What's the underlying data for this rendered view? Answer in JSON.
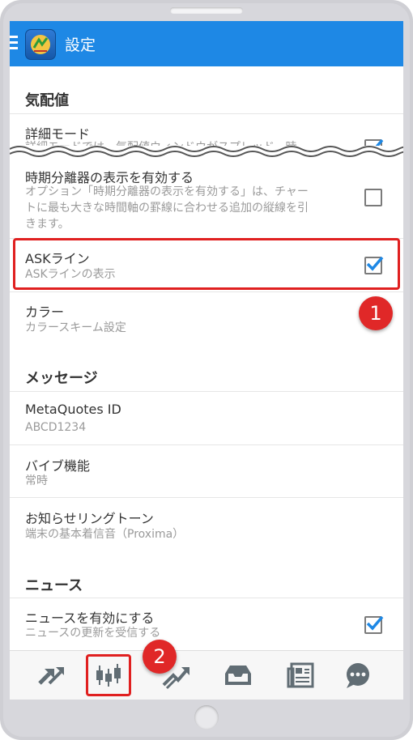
{
  "header": {
    "title": "設定",
    "app_icon": "metatrader-icon",
    "menu_icon": "hamburger-icon"
  },
  "colors": {
    "accent": "#1e88e5",
    "highlight": "#e02020",
    "check": "#1e88e5"
  },
  "sections": {
    "quotes": {
      "title": "気配値",
      "detail_mode": {
        "title": "詳細モード",
        "sub": "詳細モードでは、気配値ウィンドウがスプレッド、時",
        "checked": true
      },
      "period_sep": {
        "title": "時期分離器の表示を有効する",
        "sub_line1": "オプション「時期分離器の表示を有効する」は、チャー",
        "sub_line2": "トに最も大きな時間軸の罫線に合わせる追加の縦線を引",
        "sub_line3": "きます。",
        "checked": false
      },
      "ask_line": {
        "title": "ASKライン",
        "sub": "ASKラインの表示",
        "checked": true
      },
      "color": {
        "title": "カラー",
        "sub": "カラースキーム設定"
      }
    },
    "messages": {
      "title": "メッセージ",
      "metaquotes_id": {
        "title": "MetaQuotes ID",
        "sub": "ABCD1234"
      },
      "vibrate": {
        "title": "バイブ機能",
        "sub": "常時"
      },
      "ringtone": {
        "title": "お知らせリングトーン",
        "sub": "端末の基本着信音（Proxima）"
      }
    },
    "news": {
      "title": "ニュース",
      "enable_news": {
        "title": "ニュースを有効にする",
        "sub": "ニュースの更新を受信する",
        "checked": true
      }
    }
  },
  "annotations": {
    "badge1": "1",
    "badge2": "2"
  },
  "bottom_nav": [
    {
      "icon": "trade-arrows-icon"
    },
    {
      "icon": "candlestick-chart-icon"
    },
    {
      "icon": "trade-up-icon"
    },
    {
      "icon": "inbox-icon"
    },
    {
      "icon": "news-icon"
    },
    {
      "icon": "chat-icon"
    }
  ]
}
